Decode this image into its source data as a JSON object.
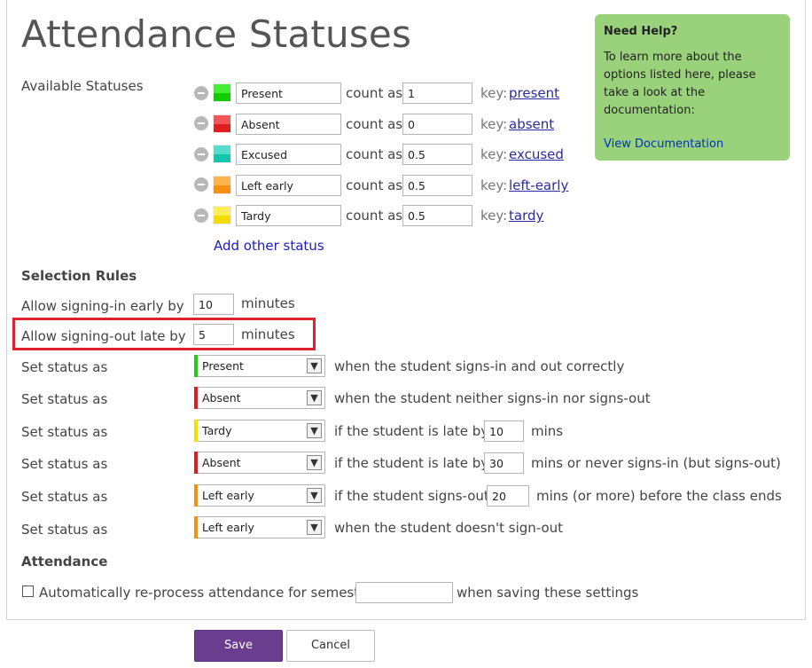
{
  "page": {
    "title": "Attendance Statuses"
  },
  "help": {
    "title": "Need Help?",
    "text": "To learn more about the options listed here, please take a look at the documentation:",
    "link": "View Documentation"
  },
  "statuses": {
    "label": "Available Statuses",
    "count_as_label": "count as",
    "key_label": "key:",
    "items": [
      {
        "name": "Present",
        "count": "1",
        "key": "present",
        "color_top": "#44ee33",
        "color_bottom": "#11cc00"
      },
      {
        "name": "Absent",
        "count": "0",
        "key": "absent",
        "color_top": "#f25555",
        "color_bottom": "#e11e1e"
      },
      {
        "name": "Excused",
        "count": "0.5",
        "key": "excused",
        "color_top": "#55ddcc",
        "color_bottom": "#14c4ac"
      },
      {
        "name": "Left early",
        "count": "0.5",
        "key": "left-early",
        "color_top": "#ffb34d",
        "color_bottom": "#f78f12"
      },
      {
        "name": "Tardy",
        "count": "0.5",
        "key": "tardy",
        "color_top": "#ffee55",
        "color_bottom": "#f5dc00"
      }
    ],
    "add_label": "Add other status"
  },
  "selection_rules": {
    "heading": "Selection Rules",
    "early": {
      "label": "Allow signing-in early by",
      "value": "10",
      "unit": "minutes"
    },
    "late": {
      "label": "Allow signing-out late by",
      "value": "5",
      "unit": "minutes"
    },
    "set_label": "Set status as",
    "rules": [
      {
        "status": "Present",
        "bar": "#22cc11",
        "text1": "when the student signs-in and out correctly"
      },
      {
        "status": "Absent",
        "bar": "#e11e1e",
        "text1": "when the student neither signs-in nor signs-out"
      },
      {
        "status": "Tardy",
        "bar": "#f5e000",
        "text1": "if the student is late by",
        "value": "10",
        "text2": "mins"
      },
      {
        "status": "Absent",
        "bar": "#e11e1e",
        "text1": "if the student is late by",
        "value": "30",
        "text2": "mins or never signs-in (but signs-out)"
      },
      {
        "status": "Left early",
        "bar": "#f78f12",
        "text1": "if the student signs-out",
        "value": "20",
        "text2": "mins (or more) before the class ends"
      },
      {
        "status": "Left early",
        "bar": "#f78f12",
        "text1": "when the student doesn't sign-out"
      }
    ]
  },
  "attendance": {
    "heading": "Attendance",
    "reprocess_label": "Automatically re-process attendance for semester",
    "semester_value": "",
    "suffix": "when saving these settings"
  },
  "buttons": {
    "save": "Save",
    "cancel": "Cancel"
  },
  "colors": {
    "accent": "#6a3d8f",
    "help_bg": "#99d27a",
    "highlight": "#e0222e",
    "link": "#2a2aa8"
  }
}
